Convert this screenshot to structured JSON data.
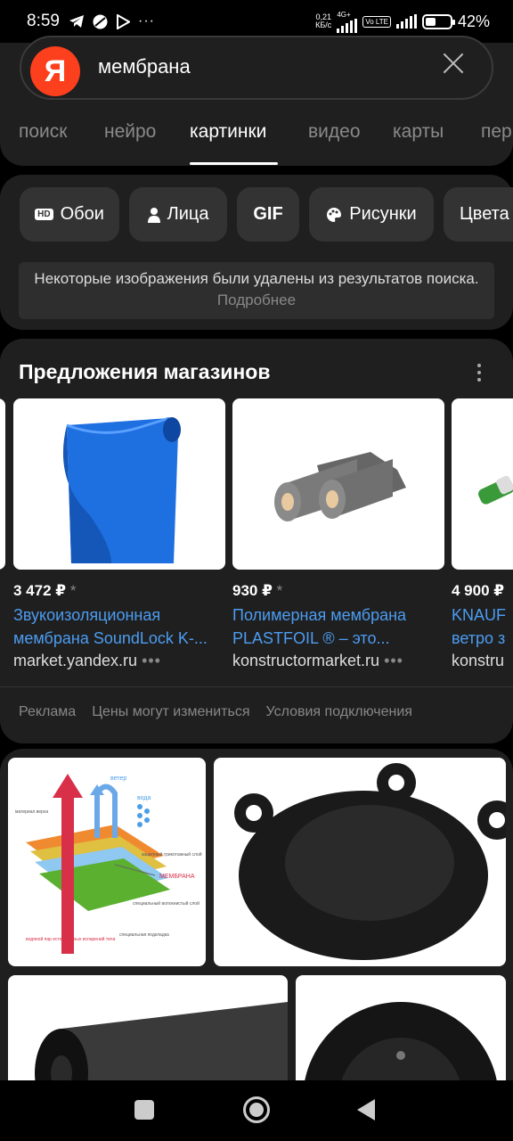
{
  "status_bar": {
    "time": "8:59",
    "net_speed_top": "0,21",
    "net_speed_bottom": "КБ/с",
    "net_type": "4G+",
    "lte": "Vo LTE",
    "battery": "42%",
    "battery_level": 0.42
  },
  "search": {
    "logo": "Я",
    "query": "мембрана"
  },
  "tabs": [
    {
      "label": "поиск"
    },
    {
      "label": "нейро"
    },
    {
      "label": "картинки"
    },
    {
      "label": "видео"
    },
    {
      "label": "карты"
    },
    {
      "label": "пер"
    }
  ],
  "filters": {
    "hd_badge": "HD",
    "chips": [
      {
        "label": "Обои"
      },
      {
        "label": "Лица"
      },
      {
        "label": "GIF"
      },
      {
        "label": "Рисунки"
      },
      {
        "label": "Цвета"
      }
    ],
    "notice_text": "Некоторые изображения были удалены из результатов поиска.",
    "notice_link": "Подробнее"
  },
  "shop": {
    "title": "Предложения магазинов",
    "products": [
      {
        "price": "3 472 ₽",
        "asterisk": "*",
        "name_line1": "Звукоизоляционная",
        "name_line2": "мембрана SoundLock K-...",
        "domain": "market.yandex.ru"
      },
      {
        "price": "930 ₽",
        "asterisk": "*",
        "name_line1": "Полимерная мембрана",
        "name_line2": "PLASTFOIL ® – это...",
        "domain": "konstructormarket.ru"
      },
      {
        "price": "4 900 ₽",
        "asterisk": "",
        "name_line1": "KNAUF",
        "name_line2": "ветро з",
        "domain": "konstru"
      }
    ],
    "footer": {
      "ad": "Реклама",
      "prices": "Цены могут измениться",
      "terms": "Условия подключения"
    }
  },
  "diagram_labels": {
    "wind": "ветер",
    "water": "вода",
    "membrane": "МЕМБРАНА",
    "top_layer": "материал верха",
    "protect_layer": "защитный трикотажный слой",
    "fiber_layer": "специальный волокнистый слой",
    "lining": "специальная подкладка",
    "vapor": "водяной пар естественных испарений тела"
  },
  "colors": {
    "accent_link": "#4c9cf1",
    "yandex_red": "#fc3f1d",
    "card_bg": "#1f1f1f"
  }
}
